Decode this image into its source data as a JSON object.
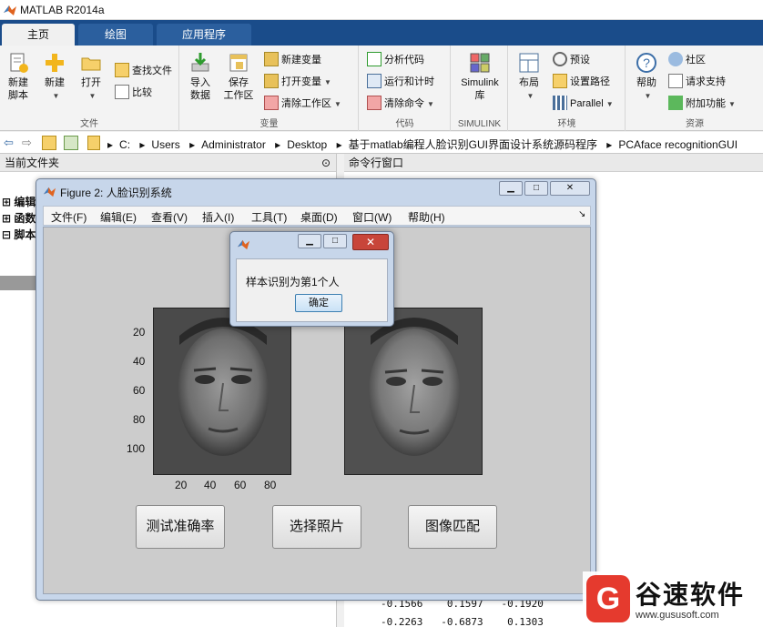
{
  "app": {
    "title": "MATLAB R2014a"
  },
  "tabs": [
    {
      "label": "主页",
      "active": true
    },
    {
      "label": "绘图",
      "active": false
    },
    {
      "label": "应用程序",
      "active": false
    }
  ],
  "ribbon": {
    "file_group": {
      "label": "文件",
      "new_script": "新建\n脚本",
      "new": "新建",
      "open": "打开",
      "find_files": "查找文件",
      "compare": "比较"
    },
    "variable_group": {
      "label": "变量",
      "import_data": "导入\n数据",
      "save_workspace": "保存\n工作区",
      "new_variable": "新建变量",
      "open_variable": "打开变量",
      "clear_workspace": "清除工作区"
    },
    "code_group": {
      "label": "代码",
      "analyze_code": "分析代码",
      "run_and_time": "运行和计时",
      "clear_commands": "清除命令"
    },
    "simulink_group": {
      "label": "SIMULINK",
      "simulink_library": "Simulink\n库"
    },
    "environment_group": {
      "label": "环境",
      "layout": "布局",
      "preferences": "预设",
      "set_path": "设置路径",
      "parallel": "Parallel"
    },
    "resources_group": {
      "label": "资源",
      "help": "帮助",
      "community": "社区",
      "request_support": "请求支持",
      "add_ons": "附加功能"
    }
  },
  "address": {
    "crumbs": [
      "C:",
      "Users",
      "Administrator",
      "Desktop",
      "基于matlab编程人脸识别GUI界面设计系统源码程序",
      "PCAface recognitionGUI"
    ]
  },
  "left_pane": {
    "title": "当前文件夹",
    "tree": [
      "编辑",
      "函数",
      "脚本"
    ]
  },
  "right_pane": {
    "title": "命令行窗口",
    "rows": [
      [
        "-0.1566",
        "0.1597",
        "-0.1920"
      ],
      [
        "-0.2263",
        "-0.6873",
        "0.1303"
      ]
    ]
  },
  "figure": {
    "title": "Figure 2: 人脸识别系统",
    "menus": [
      "文件(F)",
      "编辑(E)",
      "查看(V)",
      "插入(I)",
      "工具(T)",
      "桌面(D)",
      "窗口(W)",
      "帮助(H)"
    ],
    "y_ticks": [
      "20",
      "40",
      "60",
      "80",
      "100"
    ],
    "x_ticks": [
      "20",
      "40",
      "60",
      "80"
    ],
    "buttons": {
      "test_accuracy": "测试准确率",
      "select_photo": "选择照片",
      "image_match": "图像匹配"
    }
  },
  "msgbox": {
    "text": "样本识别为第1个人",
    "ok": "确定"
  },
  "watermark": {
    "name": "谷速软件",
    "url": "www.gususoft.com"
  }
}
